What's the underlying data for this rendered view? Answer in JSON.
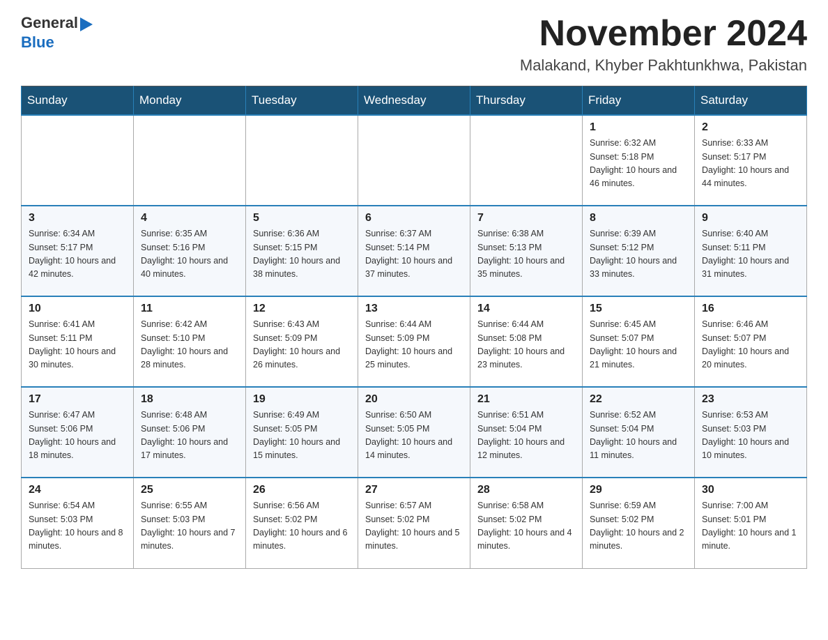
{
  "header": {
    "logo_general": "General",
    "logo_blue": "Blue",
    "month_title": "November 2024",
    "location": "Malakand, Khyber Pakhtunkhwa, Pakistan"
  },
  "weekdays": [
    "Sunday",
    "Monday",
    "Tuesday",
    "Wednesday",
    "Thursday",
    "Friday",
    "Saturday"
  ],
  "weeks": [
    [
      {
        "day": "",
        "info": ""
      },
      {
        "day": "",
        "info": ""
      },
      {
        "day": "",
        "info": ""
      },
      {
        "day": "",
        "info": ""
      },
      {
        "day": "",
        "info": ""
      },
      {
        "day": "1",
        "info": "Sunrise: 6:32 AM\nSunset: 5:18 PM\nDaylight: 10 hours and 46 minutes."
      },
      {
        "day": "2",
        "info": "Sunrise: 6:33 AM\nSunset: 5:17 PM\nDaylight: 10 hours and 44 minutes."
      }
    ],
    [
      {
        "day": "3",
        "info": "Sunrise: 6:34 AM\nSunset: 5:17 PM\nDaylight: 10 hours and 42 minutes."
      },
      {
        "day": "4",
        "info": "Sunrise: 6:35 AM\nSunset: 5:16 PM\nDaylight: 10 hours and 40 minutes."
      },
      {
        "day": "5",
        "info": "Sunrise: 6:36 AM\nSunset: 5:15 PM\nDaylight: 10 hours and 38 minutes."
      },
      {
        "day": "6",
        "info": "Sunrise: 6:37 AM\nSunset: 5:14 PM\nDaylight: 10 hours and 37 minutes."
      },
      {
        "day": "7",
        "info": "Sunrise: 6:38 AM\nSunset: 5:13 PM\nDaylight: 10 hours and 35 minutes."
      },
      {
        "day": "8",
        "info": "Sunrise: 6:39 AM\nSunset: 5:12 PM\nDaylight: 10 hours and 33 minutes."
      },
      {
        "day": "9",
        "info": "Sunrise: 6:40 AM\nSunset: 5:11 PM\nDaylight: 10 hours and 31 minutes."
      }
    ],
    [
      {
        "day": "10",
        "info": "Sunrise: 6:41 AM\nSunset: 5:11 PM\nDaylight: 10 hours and 30 minutes."
      },
      {
        "day": "11",
        "info": "Sunrise: 6:42 AM\nSunset: 5:10 PM\nDaylight: 10 hours and 28 minutes."
      },
      {
        "day": "12",
        "info": "Sunrise: 6:43 AM\nSunset: 5:09 PM\nDaylight: 10 hours and 26 minutes."
      },
      {
        "day": "13",
        "info": "Sunrise: 6:44 AM\nSunset: 5:09 PM\nDaylight: 10 hours and 25 minutes."
      },
      {
        "day": "14",
        "info": "Sunrise: 6:44 AM\nSunset: 5:08 PM\nDaylight: 10 hours and 23 minutes."
      },
      {
        "day": "15",
        "info": "Sunrise: 6:45 AM\nSunset: 5:07 PM\nDaylight: 10 hours and 21 minutes."
      },
      {
        "day": "16",
        "info": "Sunrise: 6:46 AM\nSunset: 5:07 PM\nDaylight: 10 hours and 20 minutes."
      }
    ],
    [
      {
        "day": "17",
        "info": "Sunrise: 6:47 AM\nSunset: 5:06 PM\nDaylight: 10 hours and 18 minutes."
      },
      {
        "day": "18",
        "info": "Sunrise: 6:48 AM\nSunset: 5:06 PM\nDaylight: 10 hours and 17 minutes."
      },
      {
        "day": "19",
        "info": "Sunrise: 6:49 AM\nSunset: 5:05 PM\nDaylight: 10 hours and 15 minutes."
      },
      {
        "day": "20",
        "info": "Sunrise: 6:50 AM\nSunset: 5:05 PM\nDaylight: 10 hours and 14 minutes."
      },
      {
        "day": "21",
        "info": "Sunrise: 6:51 AM\nSunset: 5:04 PM\nDaylight: 10 hours and 12 minutes."
      },
      {
        "day": "22",
        "info": "Sunrise: 6:52 AM\nSunset: 5:04 PM\nDaylight: 10 hours and 11 minutes."
      },
      {
        "day": "23",
        "info": "Sunrise: 6:53 AM\nSunset: 5:03 PM\nDaylight: 10 hours and 10 minutes."
      }
    ],
    [
      {
        "day": "24",
        "info": "Sunrise: 6:54 AM\nSunset: 5:03 PM\nDaylight: 10 hours and 8 minutes."
      },
      {
        "day": "25",
        "info": "Sunrise: 6:55 AM\nSunset: 5:03 PM\nDaylight: 10 hours and 7 minutes."
      },
      {
        "day": "26",
        "info": "Sunrise: 6:56 AM\nSunset: 5:02 PM\nDaylight: 10 hours and 6 minutes."
      },
      {
        "day": "27",
        "info": "Sunrise: 6:57 AM\nSunset: 5:02 PM\nDaylight: 10 hours and 5 minutes."
      },
      {
        "day": "28",
        "info": "Sunrise: 6:58 AM\nSunset: 5:02 PM\nDaylight: 10 hours and 4 minutes."
      },
      {
        "day": "29",
        "info": "Sunrise: 6:59 AM\nSunset: 5:02 PM\nDaylight: 10 hours and 2 minutes."
      },
      {
        "day": "30",
        "info": "Sunrise: 7:00 AM\nSunset: 5:01 PM\nDaylight: 10 hours and 1 minute."
      }
    ]
  ]
}
